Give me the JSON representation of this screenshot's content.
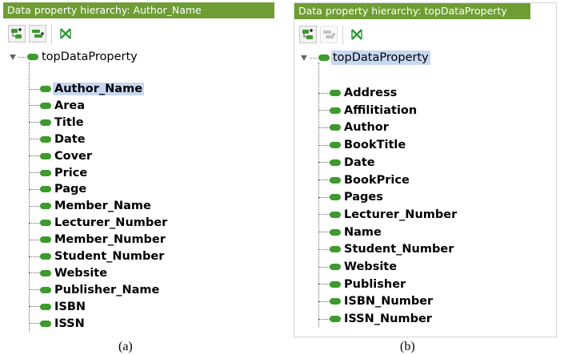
{
  "panel_a": {
    "header": "Data property hierarchy: Author_Name",
    "root": "topDataProperty",
    "items": [
      "Author_Name",
      "Area",
      "Title",
      "Date",
      "Cover",
      "Price",
      "Page",
      "Member_Name",
      "Lecturer_Number",
      "Member_Number",
      "Student_Number",
      "Website",
      "Publisher_Name",
      "ISBN",
      "ISSN"
    ],
    "selected": "Author_Name",
    "caption": "(a)"
  },
  "panel_b": {
    "header": "Data property hierarchy: topDataProperty",
    "root": "topDataProperty",
    "items": [
      "Address",
      "Affilitiation",
      "Author",
      "BookTitle",
      "Date",
      "BookPrice",
      "Pages",
      "Lecturer_Number",
      "Name",
      "Student_Number",
      "Website",
      "Publisher",
      "ISBN_Number",
      "ISSN_Number"
    ],
    "selected": "topDataProperty",
    "caption": "(b)"
  },
  "toolbar": {
    "add_subproperty_icon": "add-subproperty-icon",
    "add_sibling_icon": "add-sibling-icon",
    "delete_icon": "delete-property-icon"
  },
  "colors": {
    "header_bg": "#6f9d34",
    "node_icon": "#3d9a2c",
    "selection": "#c7d7f2"
  }
}
